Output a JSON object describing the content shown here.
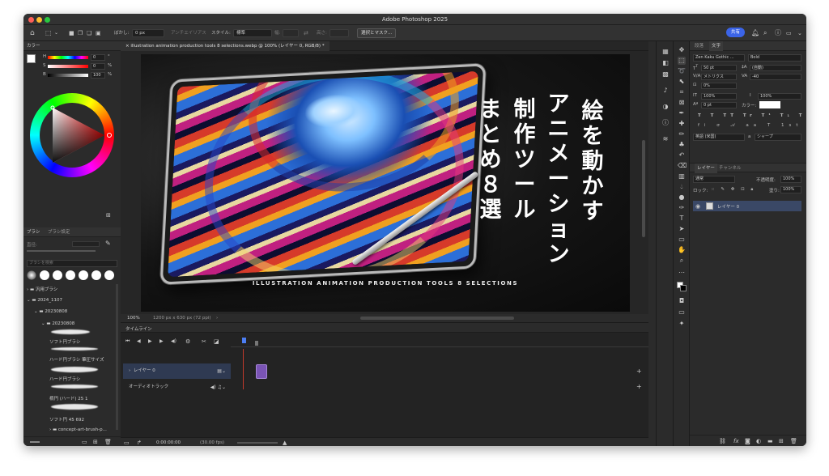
{
  "window": {
    "title": "Adobe Photoshop 2025"
  },
  "options_bar": {
    "feather_label": "ぼかし:",
    "feather_value": "0 px",
    "antialias_label": "アンチエイリアス",
    "style_label": "スタイル:",
    "style_value": "標準",
    "width_label": "幅:",
    "height_label": "高さ:",
    "select_mask_button": "選択とマスク...",
    "share_button": "共有"
  },
  "color_panel": {
    "title": "カラー",
    "sliders": [
      {
        "label": "H",
        "value": "0"
      },
      {
        "label": "S",
        "value": "0"
      },
      {
        "label": "B",
        "value": "100"
      }
    ],
    "units": [
      "°",
      "%",
      "%"
    ]
  },
  "brush_panel": {
    "tabs": [
      "ブラシ",
      "ブラシ設定"
    ],
    "size_label": "直径:",
    "search_placeholder": "ブラシを検索",
    "tree": [
      {
        "label": "汎用ブラシ",
        "level": 0
      },
      {
        "label": "2024_1107",
        "level": 0
      },
      {
        "label": "20230808",
        "level": 1
      },
      {
        "label": "20230808",
        "level": 2
      },
      {
        "label": "ソフト円ブラシ",
        "level": 3
      },
      {
        "label": "ハード円ブラシ 筆圧サイズ",
        "level": 3
      },
      {
        "label": "ハード円ブラシ",
        "level": 3
      },
      {
        "label": "楕円 (ハード) 25 1",
        "level": 3
      },
      {
        "label": "ソフト円 45 692",
        "level": 3
      },
      {
        "label": "concept-art-brush-p...",
        "level": 1
      }
    ]
  },
  "document": {
    "tab_label": "illustration animation production tools 8 selections.webp @ 100% (レイヤー 0, RGB/8) *",
    "zoom": "100%",
    "size_info": "1200 px x 630 px (72 ppi)",
    "artwork": {
      "title_columns": [
        "絵を動かす",
        "アニメーション",
        "制作ツール",
        "まとめ８選"
      ],
      "subtitle": "ILLUSTRATION ANIMATION PRODUCTION TOOLS 8 SELECTIONS"
    }
  },
  "timeline": {
    "title": "タイムライン",
    "layers": [
      {
        "label": "レイヤー 0"
      },
      {
        "label": "オーディオトラック"
      }
    ],
    "timecode": "0:00:00:00",
    "fps": "(30.00 fps)"
  },
  "character_panel": {
    "tabs": [
      "段落",
      "文字"
    ],
    "font_family": "Zen Kaku Gothic ...",
    "font_style": "Bold",
    "font_size": "50 pt",
    "leading": "(自動)",
    "kerning": "メトリクス",
    "tracking": "-40",
    "tsume": "0%",
    "vertical_scale": "100%",
    "horizontal_scale": "100%",
    "baseline": "0 pt",
    "color_label": "カラー:",
    "language": "英語 (米国)",
    "antialias": "シャープ",
    "antialias_prefix": "a"
  },
  "layers_panel": {
    "tabs": [
      "レイヤー",
      "チャンネル"
    ],
    "blend_mode": "通常",
    "opacity_label": "不透明度:",
    "opacity": "100%",
    "lock_label": "ロック:",
    "fill_label": "塗り:",
    "fill": "100%",
    "layers": [
      {
        "name": "レイヤー 0"
      }
    ]
  }
}
